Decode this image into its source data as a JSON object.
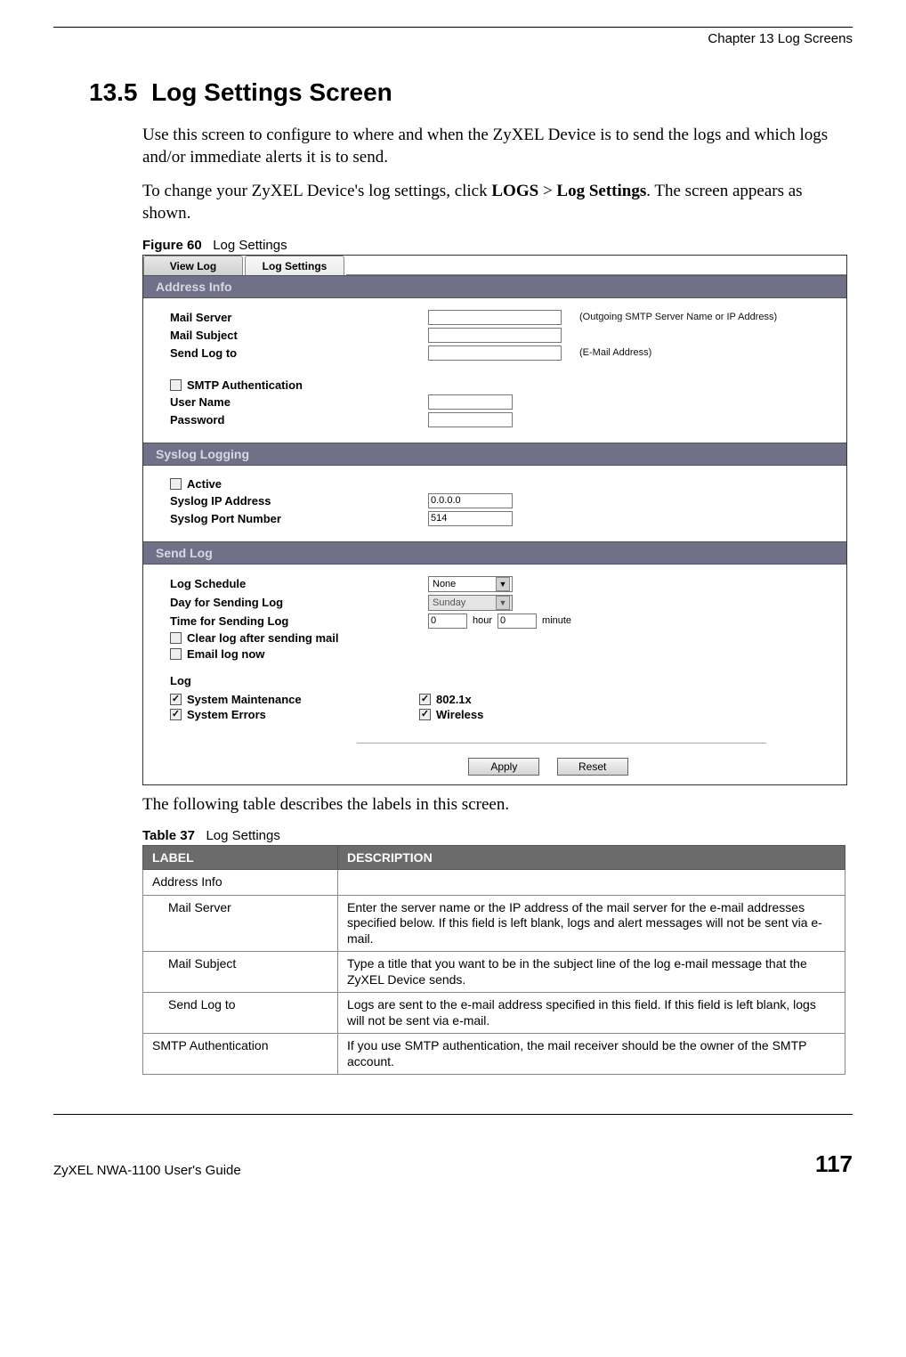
{
  "header": {
    "chapter": "Chapter 13 Log Screens"
  },
  "section": {
    "number": "13.5",
    "title": "Log Settings Screen",
    "para1": "Use this screen to configure to where and when the ZyXEL Device is to send the logs and which logs and/or immediate alerts it is to send.",
    "para2_pre": "To change your ZyXEL Device's log settings, click ",
    "para2_b1": "LOGS",
    "para2_mid": " > ",
    "para2_b2": "Log Settings",
    "para2_post": ". The screen appears as shown."
  },
  "figure": {
    "caption_label": "Figure 60",
    "caption_text": "Log Settings",
    "tabs": {
      "view_log": "View Log",
      "log_settings": "Log Settings"
    },
    "address_info": {
      "title": "Address Info",
      "mail_server": "Mail Server",
      "mail_server_hint": "(Outgoing SMTP Server Name or IP Address)",
      "mail_subject": "Mail Subject",
      "send_log_to": "Send Log to",
      "send_log_to_hint": "(E-Mail Address)",
      "smtp_auth": "SMTP Authentication",
      "user_name": "User Name",
      "password": "Password"
    },
    "syslog": {
      "title": "Syslog Logging",
      "active": "Active",
      "ip_label": "Syslog IP Address",
      "ip_value": "0.0.0.0",
      "port_label": "Syslog Port Number",
      "port_value": "514"
    },
    "send_log": {
      "title": "Send Log",
      "schedule_label": "Log Schedule",
      "schedule_value": "None",
      "day_label": "Day for Sending Log",
      "day_value": "Sunday",
      "time_label": "Time for Sending Log",
      "hour_value": "0",
      "hour_text": "hour",
      "minute_value": "0",
      "minute_text": "minute",
      "clear_log": "Clear log after sending mail",
      "email_now": "Email log now",
      "log_heading": "Log",
      "opts": {
        "sys_maint": "System Maintenance",
        "sys_err": "System Errors",
        "dot1x": "802.1x",
        "wireless": "Wireless"
      }
    },
    "buttons": {
      "apply": "Apply",
      "reset": "Reset"
    }
  },
  "after_figure": "The following table describes the labels in this screen.",
  "table": {
    "caption_label": "Table 37",
    "caption_text": "Log Settings",
    "head_label": "LABEL",
    "head_desc": "DESCRIPTION",
    "rows": [
      {
        "label": "Address Info",
        "desc": "",
        "indent": false,
        "span": true
      },
      {
        "label": "Mail Server",
        "desc": "Enter the server name or the IP address of the mail server for the e-mail addresses specified below. If this field is left blank, logs and alert messages will not be sent via e-mail.",
        "indent": true
      },
      {
        "label": "Mail Subject",
        "desc": "Type a title that you want to be in the subject line of the log e-mail message that the ZyXEL Device sends.",
        "indent": true
      },
      {
        "label": "Send Log to",
        "desc": "Logs are sent to the e-mail address specified in this field. If this field is left blank, logs will not be sent via e-mail.",
        "indent": true
      },
      {
        "label": "SMTP Authentication",
        "desc": "If you use SMTP authentication, the mail receiver should be the owner of the SMTP account.",
        "indent": false
      }
    ]
  },
  "footer": {
    "guide": "ZyXEL NWA-1100 User's Guide",
    "page": "117"
  }
}
